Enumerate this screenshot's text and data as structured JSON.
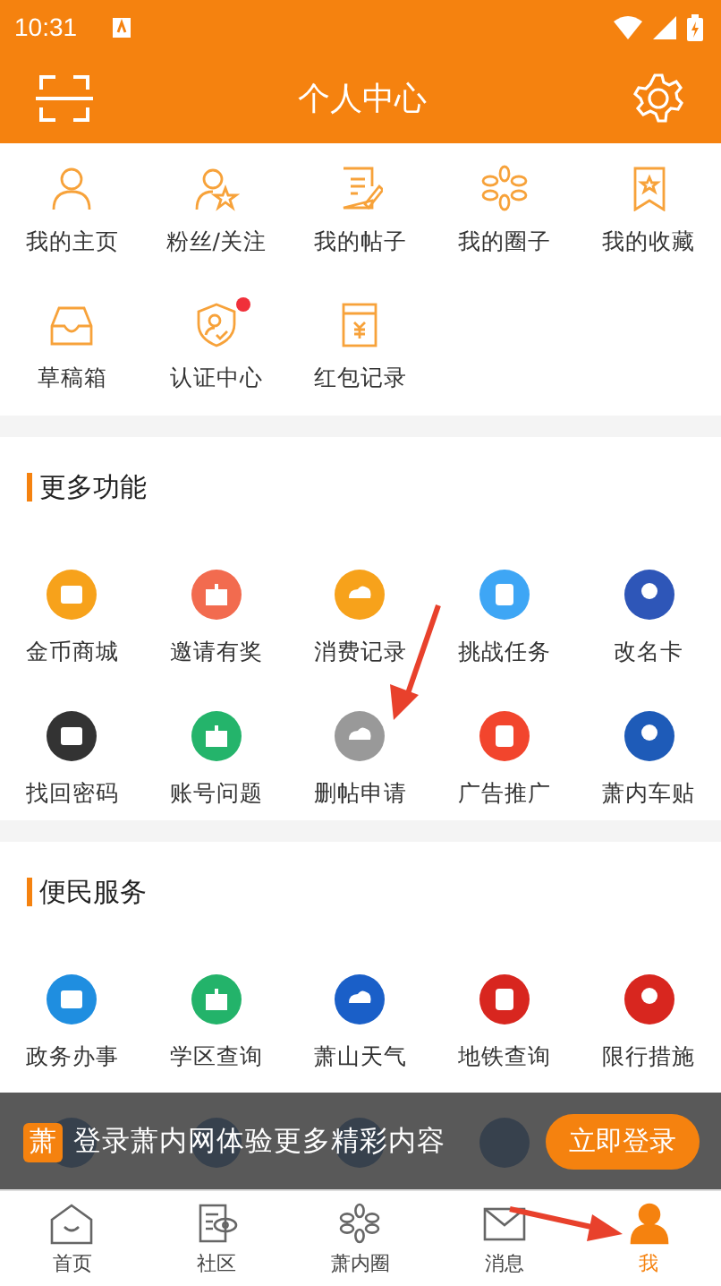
{
  "status_bar": {
    "time": "10:31"
  },
  "header": {
    "title": "个人中心"
  },
  "personal": [
    {
      "label": "我的主页",
      "dot": false
    },
    {
      "label": "粉丝/关注",
      "dot": false
    },
    {
      "label": "我的帖子",
      "dot": false
    },
    {
      "label": "我的圈子",
      "dot": false
    },
    {
      "label": "我的收藏",
      "dot": false
    },
    {
      "label": "草稿箱",
      "dot": false
    },
    {
      "label": "认证中心",
      "dot": true
    },
    {
      "label": "红包记录",
      "dot": false
    }
  ],
  "sections": [
    {
      "title": "更多功能",
      "items": [
        {
          "label": "金币商城",
          "color": "#f7a21b"
        },
        {
          "label": "邀请有奖",
          "color": "#f26b4f"
        },
        {
          "label": "消费记录",
          "color": "#f7a21b"
        },
        {
          "label": "挑战任务",
          "color": "#3ea6f5"
        },
        {
          "label": "改名卡",
          "color": "#2e56b8"
        },
        {
          "label": "找回密码",
          "color": "#333333"
        },
        {
          "label": "账号问题",
          "color": "#24b46b"
        },
        {
          "label": "删帖申请",
          "color": "#999999"
        },
        {
          "label": "广告推广",
          "color": "#f2452d"
        },
        {
          "label": "萧内车贴",
          "color": "#1e5bb8"
        }
      ]
    },
    {
      "title": "便民服务",
      "items": [
        {
          "label": "政务办事",
          "color": "#1f8ee0"
        },
        {
          "label": "学区查询",
          "color": "#23b36a"
        },
        {
          "label": "萧山天气",
          "color": "#1a5fc8"
        },
        {
          "label": "地铁查询",
          "color": "#d8261f"
        },
        {
          "label": "限行措施",
          "color": "#d8261f"
        }
      ]
    }
  ],
  "login_banner": {
    "logo": "萧",
    "text": "登录萧内网体验更多精彩内容",
    "button": "立即登录"
  },
  "tabs": [
    {
      "label": "首页",
      "selected": false
    },
    {
      "label": "社区",
      "selected": false
    },
    {
      "label": "萧内圈",
      "selected": false
    },
    {
      "label": "消息",
      "selected": false
    },
    {
      "label": "我",
      "selected": true
    }
  ]
}
